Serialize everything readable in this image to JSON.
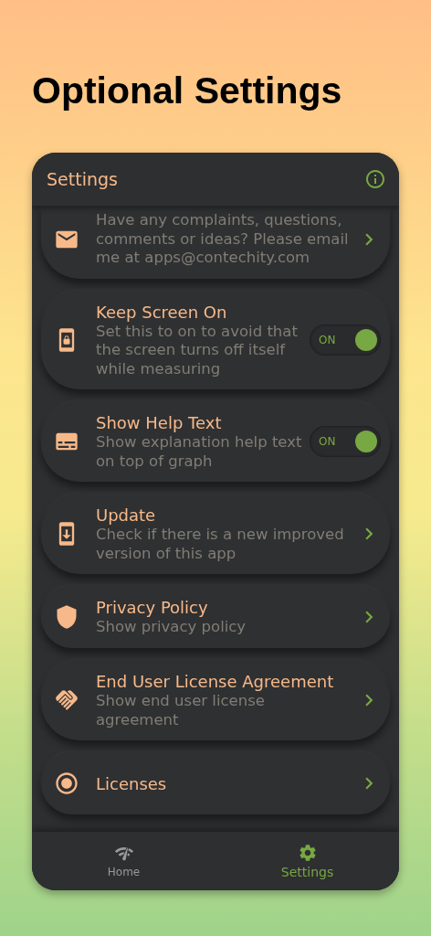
{
  "headline": "Optional Settings",
  "header": {
    "title": "Settings"
  },
  "items": [
    {
      "kind": "link",
      "description": "Have any complaints, questions, comments or ideas? Please email me at apps@contechity.com"
    },
    {
      "kind": "toggle",
      "title": "Keep Screen On",
      "description": "Set this to on to avoid that the screen turns off itself while measuring",
      "on": true,
      "toggle_label": "ON"
    },
    {
      "kind": "toggle",
      "title": "Show Help Text",
      "description": "Show explanation help text on top of graph",
      "on": true,
      "toggle_label": "ON"
    },
    {
      "kind": "link",
      "title": "Update",
      "description": "Check if there is a new improved version of this app"
    },
    {
      "kind": "link",
      "title": "Privacy Policy",
      "description": "Show privacy policy"
    },
    {
      "kind": "link",
      "title": "End User License Agreement",
      "description": "Show end user license agreement"
    },
    {
      "kind": "link",
      "title": "Licenses"
    }
  ],
  "tabs": [
    {
      "label": "Home",
      "selected": false
    },
    {
      "label": "Settings",
      "selected": true
    }
  ]
}
